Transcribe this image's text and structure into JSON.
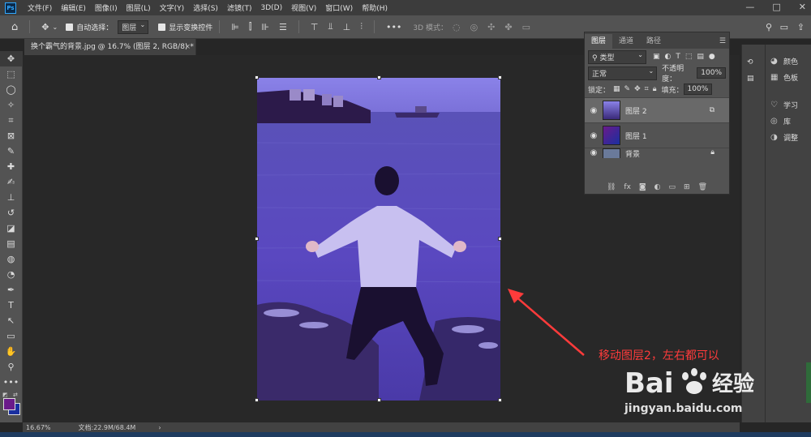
{
  "menubar": {
    "app_logo": "Ps",
    "items": [
      "文件(F)",
      "编辑(E)",
      "图像(I)",
      "图层(L)",
      "文字(Y)",
      "选择(S)",
      "滤镜(T)",
      "3D(D)",
      "视图(V)",
      "窗口(W)",
      "帮助(H)"
    ],
    "controls": [
      "—",
      "□",
      "✕"
    ]
  },
  "optionsbar": {
    "auto_select_label": "自动选择：",
    "auto_select_value": "图层",
    "show_transform_label": "显示变换控件",
    "mode_3d_label": "3D 模式："
  },
  "document": {
    "tab_title": "换个霸气的背景.jpg @ 16.7% (图层 2, RGB/8) *",
    "close": "×"
  },
  "annotation": {
    "text": "移动图层2，左右都可以",
    "color": "#ff3b3b"
  },
  "layers_panel": {
    "tabs": [
      "图层",
      "通道",
      "路径"
    ],
    "filter_label": "类型",
    "blend_mode": "正常",
    "opacity_label": "不透明度：",
    "opacity_value": "100%",
    "lock_label": "锁定：",
    "fill_label": "填充：",
    "fill_value": "100%",
    "layers": [
      {
        "name": "图层 2",
        "visible": true,
        "selected": true
      },
      {
        "name": "图层 1",
        "visible": true,
        "selected": false
      },
      {
        "name": "背景",
        "visible": true,
        "selected": false
      }
    ],
    "footer_icons": [
      "link-icon",
      "fx-icon",
      "mask-icon",
      "adjustment-icon",
      "folder-icon",
      "new-layer-icon",
      "trash-icon"
    ]
  },
  "right_panel": {
    "items": [
      {
        "icon": "color-icon",
        "label": "颜色"
      },
      {
        "icon": "swatches-icon",
        "label": "色板"
      },
      {
        "icon": "learn-icon",
        "label": "学习"
      },
      {
        "icon": "library-icon",
        "label": "库"
      },
      {
        "icon": "adjust-icon",
        "label": "调整"
      }
    ]
  },
  "statusbar": {
    "zoom": "16.67%",
    "doc_size": "文档:22.9M/68.4M",
    "arrow": "›"
  },
  "watermark": {
    "brand": "Bai",
    "brand_cn": "经验",
    "url": "jingyan.baidu.com"
  },
  "colors": {
    "foreground": "#6a1a8a",
    "background": "#1a2fa0",
    "accent": "#31a8ff"
  }
}
